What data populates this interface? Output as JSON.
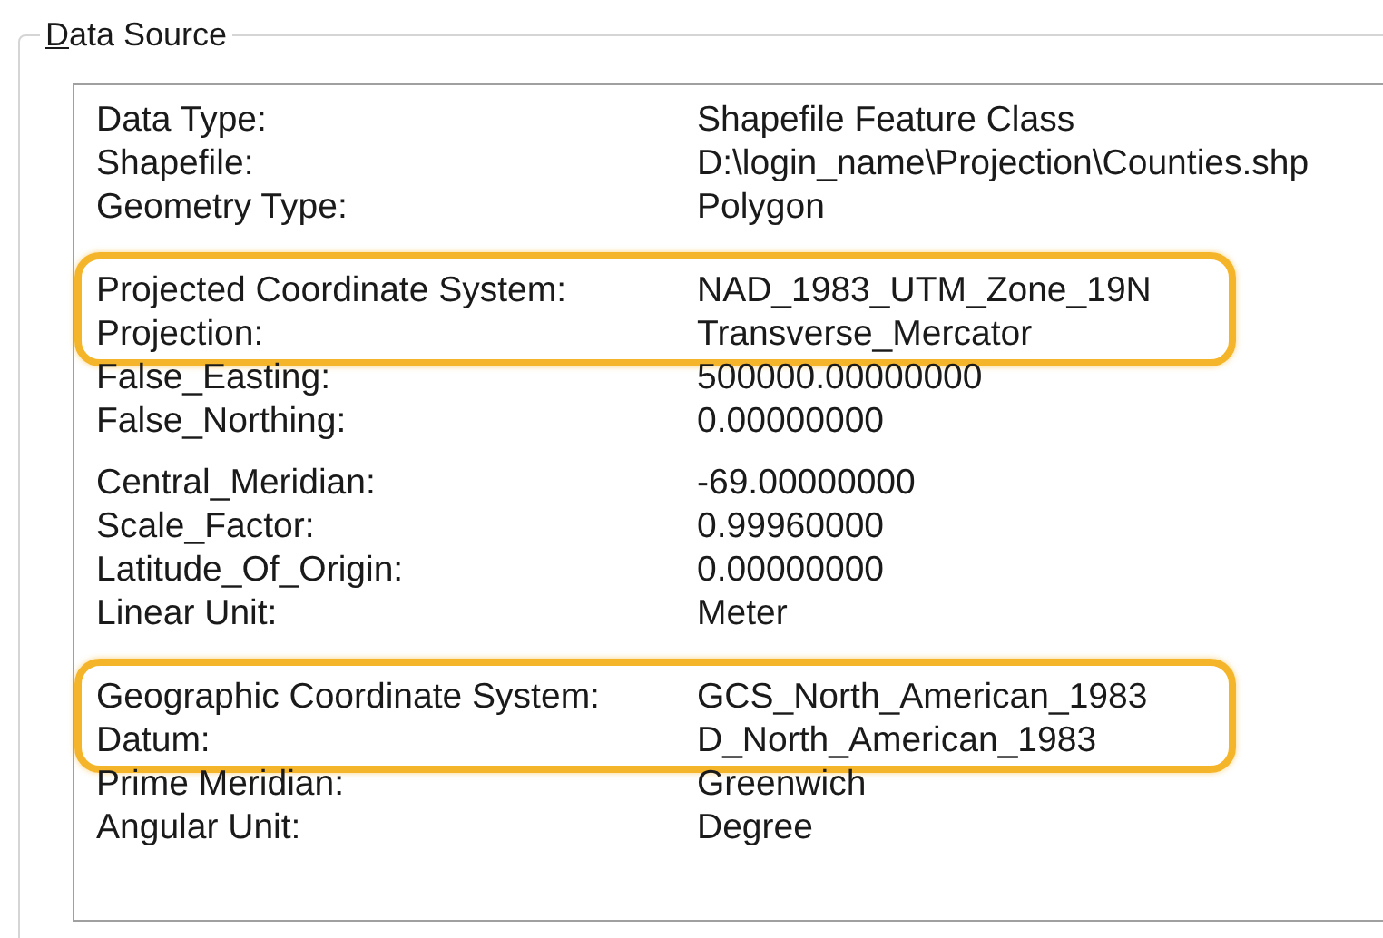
{
  "group_box": {
    "title_parts": [
      {
        "text": "D",
        "underlined": true
      },
      {
        "text": "ata Source",
        "underlined": false
      }
    ]
  },
  "sections": [
    {
      "rows": [
        {
          "label": "Data Type:",
          "value": "Shapefile Feature Class",
          "highlighted": false
        },
        {
          "label": "Shapefile:",
          "value": "D:\\login_name\\Projection\\Counties.shp",
          "highlighted": false
        },
        {
          "label": "Geometry Type:",
          "value": "Polygon",
          "highlighted": false
        }
      ]
    },
    {
      "rows": [
        {
          "label": "Projected Coordinate System:",
          "value": "NAD_1983_UTM_Zone_19N",
          "highlighted": true
        },
        {
          "label": "Projection:",
          "value": "Transverse_Mercator",
          "highlighted": true
        },
        {
          "label": "False_Easting:",
          "value": "500000.00000000",
          "highlighted": false
        },
        {
          "label": "False_Northing:",
          "value": "0.00000000",
          "highlighted": false
        }
      ]
    },
    {
      "rows": [
        {
          "label": "Central_Meridian:",
          "value": "-69.00000000",
          "highlighted": false
        },
        {
          "label": "Scale_Factor:",
          "value": "0.99960000",
          "highlighted": false
        },
        {
          "label": "Latitude_Of_Origin:",
          "value": "0.00000000",
          "highlighted": false
        },
        {
          "label": "Linear Unit:",
          "value": "Meter",
          "highlighted": false
        }
      ]
    },
    {
      "rows": [
        {
          "label": "Geographic Coordinate System:",
          "value": "GCS_North_American_1983",
          "highlighted": true
        },
        {
          "label": "Datum:",
          "value": "D_North_American_1983",
          "highlighted": true
        },
        {
          "label": "Prime Meridian:",
          "value": "Greenwich",
          "highlighted": false
        },
        {
          "label": "Angular Unit:",
          "value": "Degree",
          "highlighted": false
        }
      ]
    }
  ]
}
